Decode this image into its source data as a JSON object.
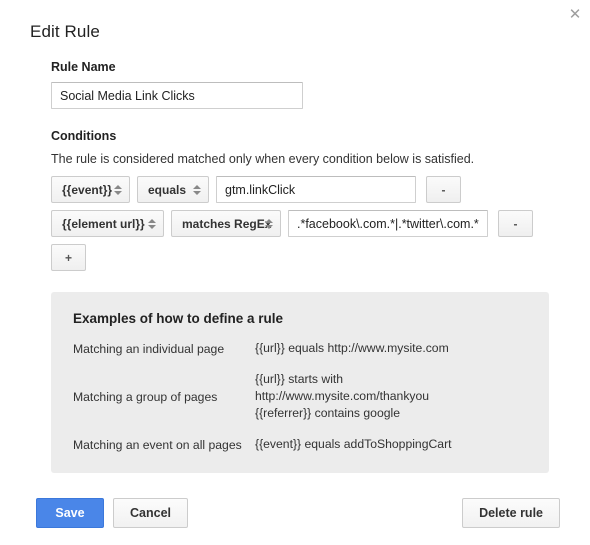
{
  "dialog": {
    "title": "Edit Rule",
    "close_icon": "close-icon",
    "close_glyph": "✕"
  },
  "rule_name": {
    "label": "Rule Name",
    "value": "Social Media Link Clicks",
    "placeholder": ""
  },
  "conditions": {
    "label": "Conditions",
    "description": "The rule is considered matched only when every condition below is satisfied.",
    "rows": [
      {
        "variable": "{{event}}",
        "operator": "equals",
        "value": "gtm.linkClick",
        "remove_label": "-"
      },
      {
        "variable": "{{element url}}",
        "operator": "matches RegEx",
        "value": ".*facebook\\.com.*|.*twitter\\.com.*|.*",
        "remove_label": "-"
      }
    ],
    "add_label": "+"
  },
  "examples": {
    "title": "Examples of how to define a rule",
    "rows": [
      {
        "key": "Matching an individual page",
        "value": "{{url}} equals http://www.mysite.com"
      },
      {
        "key": "Matching a group of pages",
        "value": "{{url}} starts with\nhttp://www.mysite.com/thankyou\n{{referrer}} contains google"
      },
      {
        "key": "Matching an event on all pages",
        "value": "{{event}} equals addToShoppingCart"
      }
    ]
  },
  "footer": {
    "save_label": "Save",
    "cancel_label": "Cancel",
    "delete_label": "Delete rule"
  },
  "colors": {
    "primary": "#4a86e8",
    "panel_bg": "#ececec",
    "page_bg": "#ffffff",
    "text": "#222222",
    "border": "#cccccc"
  }
}
